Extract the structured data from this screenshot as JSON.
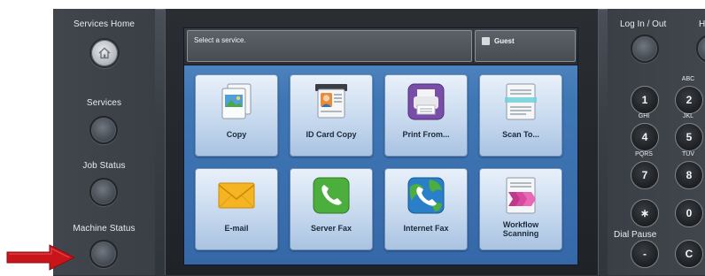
{
  "left_panel": {
    "services_home_label": "Services Home",
    "services_label": "Services",
    "job_status_label": "Job Status",
    "machine_status_label": "Machine Status"
  },
  "screen": {
    "message": "Select a service.",
    "user": "Guest",
    "tiles": [
      {
        "label": "Copy",
        "icon": "copy-icon"
      },
      {
        "label": "ID Card Copy",
        "icon": "id-card-icon"
      },
      {
        "label": "Print From...",
        "icon": "printer-icon"
      },
      {
        "label": "Scan To...",
        "icon": "scanner-icon"
      },
      {
        "label": "E-mail",
        "icon": "envelope-icon"
      },
      {
        "label": "Server Fax",
        "icon": "phone-icon"
      },
      {
        "label": "Internet Fax",
        "icon": "globe-phone-icon"
      },
      {
        "label_line1": "Workflow",
        "label_line2": "Scanning",
        "icon": "workflow-icon"
      }
    ]
  },
  "right_panel": {
    "log_in_label": "Log In / Out",
    "partial_label": "H",
    "dial_pause_label": "Dial Pause",
    "keys": {
      "k1": "1",
      "k2": "2",
      "k4": "4",
      "k5": "5",
      "k7": "7",
      "k8": "8",
      "star": "∗",
      "k0": "0",
      "pause": "-",
      "clear": "C"
    },
    "letters": {
      "abc": "ABC",
      "ghi": "GHI",
      "jkl": "JKL",
      "pqrs": "PQRS",
      "tuv": "TUV"
    }
  },
  "colors": {
    "screen_blue": "#3f77b5",
    "arrow_red": "#c8151b",
    "panel_dark": "#3a3f45"
  }
}
